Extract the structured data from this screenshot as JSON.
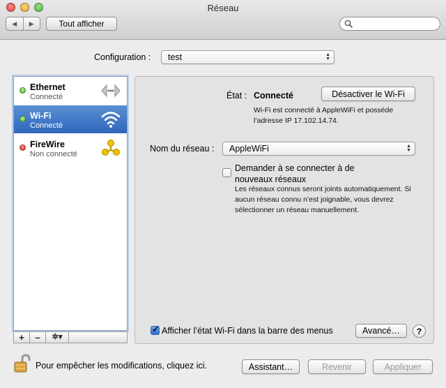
{
  "window": {
    "title": "Réseau"
  },
  "toolbar": {
    "show_all": "Tout afficher",
    "back_icon": "chevron-left-icon",
    "forward_icon": "chevron-right-icon",
    "search_placeholder": ""
  },
  "configuration": {
    "label": "Configuration :",
    "value": "test"
  },
  "services": [
    {
      "name": "Ethernet",
      "status": "Connecté",
      "led": "green",
      "icon": "ethernet-icon",
      "selected": false
    },
    {
      "name": "Wi-Fi",
      "status": "Connecté",
      "led": "green",
      "icon": "wifi-icon",
      "selected": true
    },
    {
      "name": "FireWire",
      "status": "Non connecté",
      "led": "red",
      "icon": "firewire-icon",
      "selected": false
    }
  ],
  "sidebar_toolbar": {
    "add": "+",
    "remove": "–",
    "gear": "✲▾"
  },
  "detail": {
    "status_label": "État :",
    "status_value": "Connecté",
    "wifi_toggle_button": "Désactiver le Wi-Fi",
    "status_description": "Wi-Fi est connecté à AppleWiFi et possède l’adresse IP 17.102.14.74.",
    "network_name_label": "Nom du réseau :",
    "network_name_value": "AppleWiFi",
    "ask_to_join_label": "Demander à se connecter à de nouveaux réseaux",
    "ask_to_join_checked": false,
    "ask_to_join_description": "Les réseaux connus seront joints automatiquement. Si aucun réseau connu n’est joignable, vous devrez sélectionner un réseau manuellement.",
    "show_status_label": "Afficher l’état Wi-Fi dans la barre des menus",
    "show_status_checked": true,
    "advanced_button": "Avancé…",
    "help_button": "?"
  },
  "footer": {
    "lock_text": "Pour empêcher les modifications, cliquez ici.",
    "assistant_button": "Assistant…",
    "revert_button": "Revenir",
    "apply_button": "Appliquer"
  },
  "colors": {
    "selection": "#3a70c6",
    "led_green": "#3db72b",
    "led_red": "#d9231c",
    "wifi_icon": "#ffffff",
    "firewire_icon": "#e8b800"
  }
}
